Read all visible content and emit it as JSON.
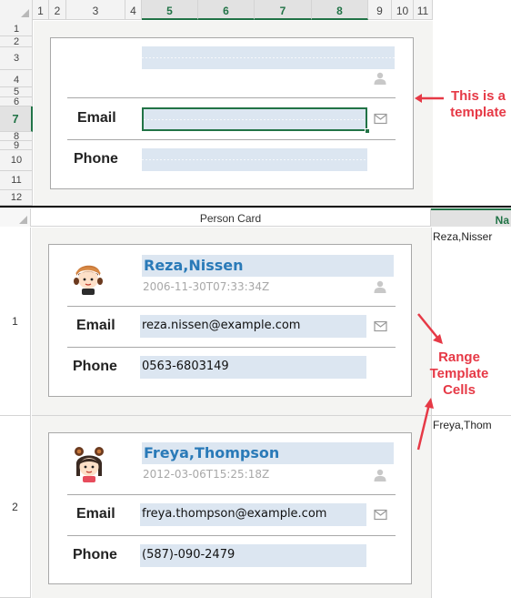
{
  "template_sheet": {
    "columns": [
      "1",
      "2",
      "3",
      "4",
      "5",
      "6",
      "7",
      "8",
      "9",
      "10",
      "11"
    ],
    "rows": [
      "1",
      "2",
      "3",
      "4",
      "5",
      "6",
      "7",
      "8",
      "9",
      "10",
      "11",
      "12"
    ],
    "selected_row": "7",
    "card": {
      "email_label": "Email",
      "phone_label": "Phone"
    }
  },
  "annotations": {
    "template_note": [
      "This is a",
      "template"
    ],
    "range_note": [
      "Range",
      "Template",
      "Cells"
    ]
  },
  "results_sheet": {
    "column_header": "Person Card",
    "side_column_header": "Na",
    "people": [
      {
        "row": "1",
        "name": "Reza,Nissen",
        "date": "2006-11-30T07:33:34Z",
        "email_label": "Email",
        "email": "reza.nissen@example.com",
        "phone_label": "Phone",
        "phone": "0563-6803149",
        "side_name": "Reza,Nisser",
        "avatar": "boy-avatar"
      },
      {
        "row": "2",
        "name": "Freya,Thompson",
        "date": "2012-03-06T15:25:18Z",
        "email_label": "Email",
        "email": "freya.thompson@example.com",
        "phone_label": "Phone",
        "phone": "(587)-090-2479",
        "side_name": "Freya,Thom",
        "avatar": "girl-avatar"
      }
    ]
  },
  "colors": {
    "accent": "#217346",
    "annotation": "#e63946",
    "name": "#2a7ab8",
    "field": "#dce6f1"
  }
}
